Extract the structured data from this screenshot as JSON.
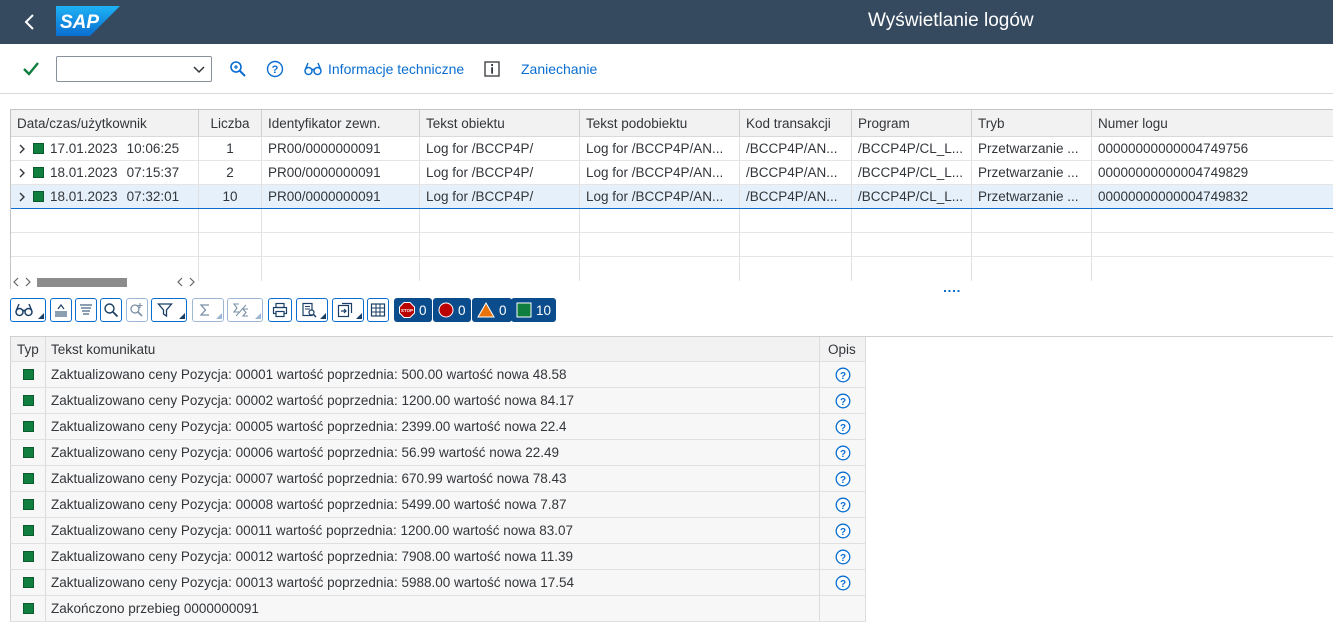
{
  "shell": {
    "title": "Wyświetlanie logów",
    "logo_text": "SAP",
    "back_icon": "chevron-left-icon"
  },
  "toolbar": {
    "confirm_icon": "checkmark-icon",
    "select_value": "",
    "search_icon": "search-icon",
    "help_icon": "help-icon",
    "tech_info_label": "Informacje techniczne",
    "info_icon": "info-icon",
    "cancel_label": "Zaniechanie"
  },
  "log_table": {
    "columns": [
      "Data/czas/użytkownik",
      "Liczba",
      "Identyfikator zewn.",
      "Tekst obiektu",
      "Tekst podobiektu",
      "Kod transakcji",
      "Program",
      "Tryb",
      "Numer logu"
    ],
    "rows": [
      {
        "date": "17.01.2023",
        "time": "10:06:25",
        "count": "1",
        "ext_id": "PR00/0000000091",
        "object_text": "Log for /BCCP4P/",
        "subobject_text": "Log for /BCCP4P/AN...",
        "tcode": "/BCCP4P/AN...",
        "program": "/BCCP4P/CL_L...",
        "mode": "Przetwarzanie ...",
        "log_no": "00000000000004749756"
      },
      {
        "date": "18.01.2023",
        "time": "07:15:37",
        "count": "2",
        "ext_id": "PR00/0000000091",
        "object_text": "Log for /BCCP4P/",
        "subobject_text": "Log for /BCCP4P/AN...",
        "tcode": "/BCCP4P/AN...",
        "program": "/BCCP4P/CL_L...",
        "mode": "Przetwarzanie ...",
        "log_no": "00000000000004749829"
      },
      {
        "date": "18.01.2023",
        "time": "07:32:01",
        "count": "10",
        "ext_id": "PR00/0000000091",
        "object_text": "Log for /BCCP4P/",
        "subobject_text": "Log for /BCCP4P/AN...",
        "tcode": "/BCCP4P/AN...",
        "program": "/BCCP4P/CL_L...",
        "mode": "Przetwarzanie ...",
        "log_no": "00000000000004749832"
      }
    ],
    "selected_row": 2
  },
  "counters": {
    "stop": "0",
    "error": "0",
    "warning": "0",
    "success": "10",
    "colors": {
      "stop": "#bb0000",
      "error": "#bb0000",
      "warning": "#e9730c",
      "success": "#107e3e"
    }
  },
  "messages": {
    "columns": [
      "Typ",
      "Tekst komunikatu",
      "Opis"
    ],
    "rows": [
      {
        "text": "Zaktualizowano ceny Pozycja: 00001 wartość poprzednia: 500.00 wartość nowa 48.58",
        "has_help": true
      },
      {
        "text": "Zaktualizowano ceny Pozycja: 00002 wartość poprzednia: 1200.00 wartość nowa 84.17",
        "has_help": true
      },
      {
        "text": "Zaktualizowano ceny Pozycja: 00005 wartość poprzednia: 2399.00 wartość nowa 22.4",
        "has_help": true
      },
      {
        "text": "Zaktualizowano ceny Pozycja: 00006 wartość poprzednia: 56.99 wartość nowa 22.49",
        "has_help": true
      },
      {
        "text": "Zaktualizowano ceny Pozycja: 00007 wartość poprzednia: 670.99 wartość nowa 78.43",
        "has_help": true
      },
      {
        "text": "Zaktualizowano ceny Pozycja: 00008 wartość poprzednia: 5499.00 wartość nowa 7.87",
        "has_help": true
      },
      {
        "text": "Zaktualizowano ceny Pozycja: 00011 wartość poprzednia: 1200.00 wartość nowa 83.07",
        "has_help": true
      },
      {
        "text": "Zaktualizowano ceny Pozycja: 00012 wartość poprzednia: 7908.00 wartość nowa 11.39",
        "has_help": true
      },
      {
        "text": "Zaktualizowano ceny Pozycja: 00013 wartość poprzednia: 5988.00 wartość nowa 17.54",
        "has_help": true
      },
      {
        "text": "Zakończono przebieg 0000000091",
        "has_help": false
      }
    ]
  },
  "colors": {
    "shell_bg": "#354a5f",
    "accent": "#0a6ed1",
    "success": "#107e3e",
    "counter_bg": "#0a4c8c"
  }
}
